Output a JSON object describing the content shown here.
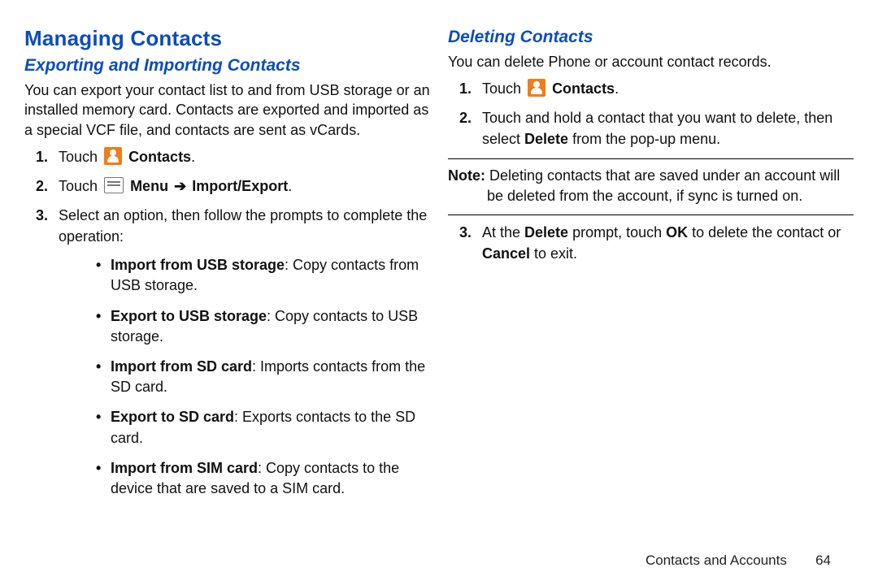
{
  "left": {
    "heading": "Managing Contacts",
    "subheading": "Exporting and Importing Contacts",
    "intro": "You can export your contact list to and from USB storage or an installed memory card. Contacts are exported and imported as a special VCF file, and contacts are sent as vCards.",
    "step1": {
      "num": "1.",
      "pre": "Touch ",
      "bold": "Contacts",
      "post": "."
    },
    "step2": {
      "num": "2.",
      "pre": "Touch ",
      "bold1": "Menu",
      "arrow": "➔",
      "bold2": "Import/Export",
      "post": "."
    },
    "step3": {
      "num": "3.",
      "text": "Select an option, then follow the prompts to complete the operation:"
    },
    "bullets": [
      {
        "bold": "Import from USB storage",
        "rest": ": Copy contacts from USB storage."
      },
      {
        "bold": "Export to USB storage",
        "rest": ": Copy contacts to USB storage."
      },
      {
        "bold": "Import from SD card",
        "rest": ": Imports contacts from the SD card."
      },
      {
        "bold": "Export to SD card",
        "rest": ": Exports contacts to the SD card."
      },
      {
        "bold": "Import from SIM card",
        "rest": ": Copy contacts to the device that are saved to a SIM card."
      }
    ]
  },
  "right": {
    "subheading": "Deleting Contacts",
    "intro": "You can delete Phone or account contact records.",
    "step1": {
      "num": "1.",
      "pre": "Touch ",
      "bold": "Contacts",
      "post": "."
    },
    "step2": {
      "num": "2.",
      "a": "Touch and hold a contact that you want to delete, then select ",
      "b": "Delete",
      "c": " from the pop-up menu."
    },
    "noteLabel": "Note:",
    "noteLine1": " Deleting contacts that are saved under an account will",
    "noteLine2": "be deleted from the account, if sync is turned on.",
    "step3": {
      "num": "3.",
      "a": "At the ",
      "b": "Delete",
      "c": " prompt, touch ",
      "d": "OK",
      "e": " to delete the contact or ",
      "f": "Cancel",
      "g": " to exit."
    }
  },
  "footer": {
    "chapter": "Contacts and Accounts",
    "page": "64"
  }
}
